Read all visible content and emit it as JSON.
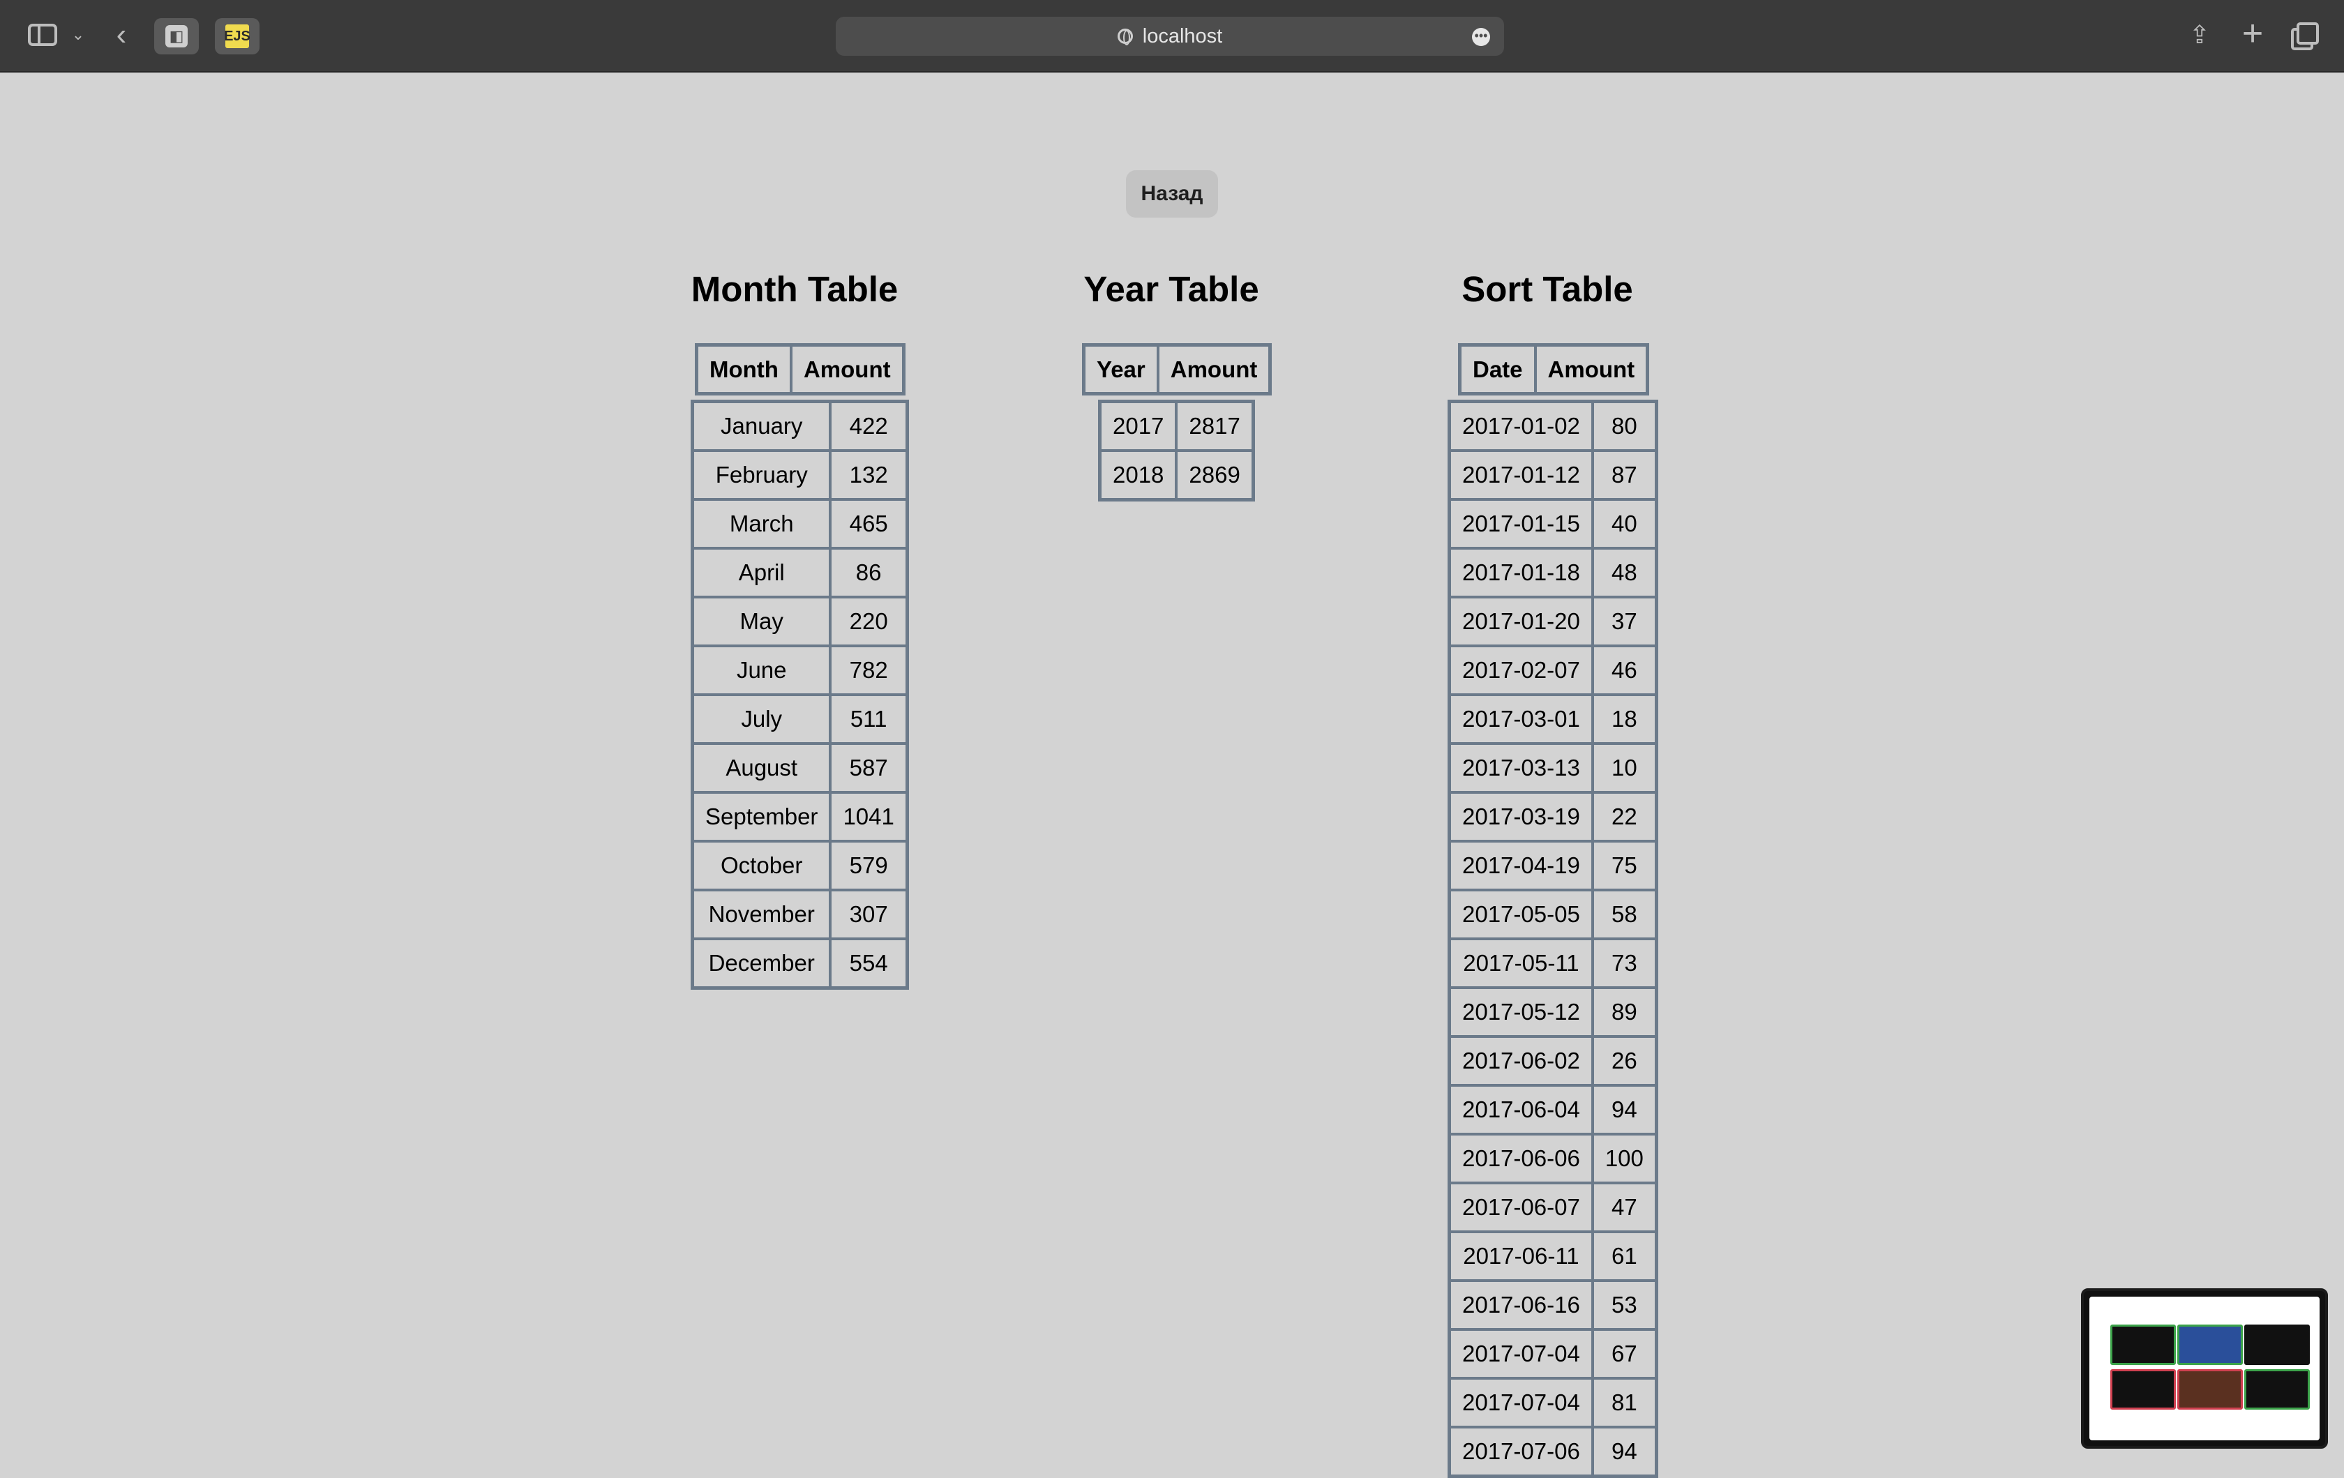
{
  "browser": {
    "url": "localhost"
  },
  "page": {
    "back_button": "Назад",
    "month_table": {
      "title": "Month Table",
      "headers": [
        "Month",
        "Amount"
      ],
      "rows": [
        [
          "January",
          "422"
        ],
        [
          "February",
          "132"
        ],
        [
          "March",
          "465"
        ],
        [
          "April",
          "86"
        ],
        [
          "May",
          "220"
        ],
        [
          "June",
          "782"
        ],
        [
          "July",
          "511"
        ],
        [
          "August",
          "587"
        ],
        [
          "September",
          "1041"
        ],
        [
          "October",
          "579"
        ],
        [
          "November",
          "307"
        ],
        [
          "December",
          "554"
        ]
      ]
    },
    "year_table": {
      "title": "Year Table",
      "headers": [
        "Year",
        "Amount"
      ],
      "rows": [
        [
          "2017",
          "2817"
        ],
        [
          "2018",
          "2869"
        ]
      ]
    },
    "sort_table": {
      "title": "Sort Table",
      "headers": [
        "Date",
        "Amount"
      ],
      "rows": [
        [
          "2017-01-02",
          "80"
        ],
        [
          "2017-01-12",
          "87"
        ],
        [
          "2017-01-15",
          "40"
        ],
        [
          "2017-01-18",
          "48"
        ],
        [
          "2017-01-20",
          "37"
        ],
        [
          "2017-02-07",
          "46"
        ],
        [
          "2017-03-01",
          "18"
        ],
        [
          "2017-03-13",
          "10"
        ],
        [
          "2017-03-19",
          "22"
        ],
        [
          "2017-04-19",
          "75"
        ],
        [
          "2017-05-05",
          "58"
        ],
        [
          "2017-05-11",
          "73"
        ],
        [
          "2017-05-12",
          "89"
        ],
        [
          "2017-06-02",
          "26"
        ],
        [
          "2017-06-04",
          "94"
        ],
        [
          "2017-06-06",
          "100"
        ],
        [
          "2017-06-07",
          "47"
        ],
        [
          "2017-06-11",
          "61"
        ],
        [
          "2017-06-16",
          "53"
        ],
        [
          "2017-07-04",
          "67"
        ],
        [
          "2017-07-04",
          "81"
        ],
        [
          "2017-07-06",
          "94"
        ]
      ]
    }
  },
  "icons": {
    "sidebar": "sidebar-toggle-icon",
    "chevron": "chevron-down-icon",
    "back": "back-arrow-icon",
    "globe": "globe-icon",
    "more": "more-icon",
    "share": "share-icon",
    "new_tab": "plus-icon",
    "tabs": "tab-overview-icon"
  }
}
